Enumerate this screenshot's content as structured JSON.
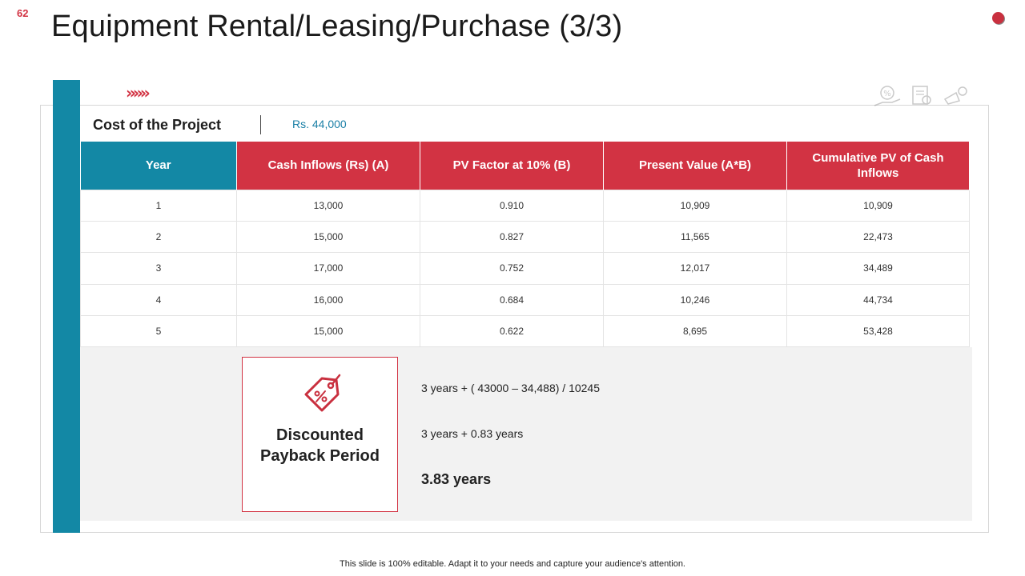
{
  "slide": {
    "number": "62",
    "title": "Equipment Rental/Leasing/Purchase  (3/3)",
    "accent_color": "#d23343",
    "teal_color": "#1388a5"
  },
  "cost": {
    "label": "Cost of the Project",
    "value": "Rs. 44,000"
  },
  "decor": {
    "chevrons": "»»»",
    "icons": [
      "percent-hand-icon",
      "document-icon",
      "megaphone-icon"
    ]
  },
  "table": {
    "headers": [
      "Year",
      "Cash Inflows (Rs) (A)",
      "PV Factor at 10% (B)",
      "Present Value (A*B)",
      "Cumulative PV of Cash Inflows"
    ],
    "rows": [
      [
        "1",
        "13,000",
        "0.910",
        "10,909",
        "10,909"
      ],
      [
        "2",
        "15,000",
        "0.827",
        "11,565",
        "22,473"
      ],
      [
        "3",
        "17,000",
        "0.752",
        "12,017",
        "34,489"
      ],
      [
        "4",
        "16,000",
        "0.684",
        "10,246",
        "44,734"
      ],
      [
        "5",
        "15,000",
        "0.622",
        "8,695",
        "53,428"
      ]
    ]
  },
  "payback": {
    "title": "Discounted Payback Period",
    "icon": "discount-tag-icon",
    "line1": "3 years + ( 43000 – 34,488) / 10245",
    "line2": "3 years + 0.83 years",
    "result": "3.83 years"
  },
  "footer": "This slide is 100% editable. Adapt it to your needs and capture your audience's attention."
}
